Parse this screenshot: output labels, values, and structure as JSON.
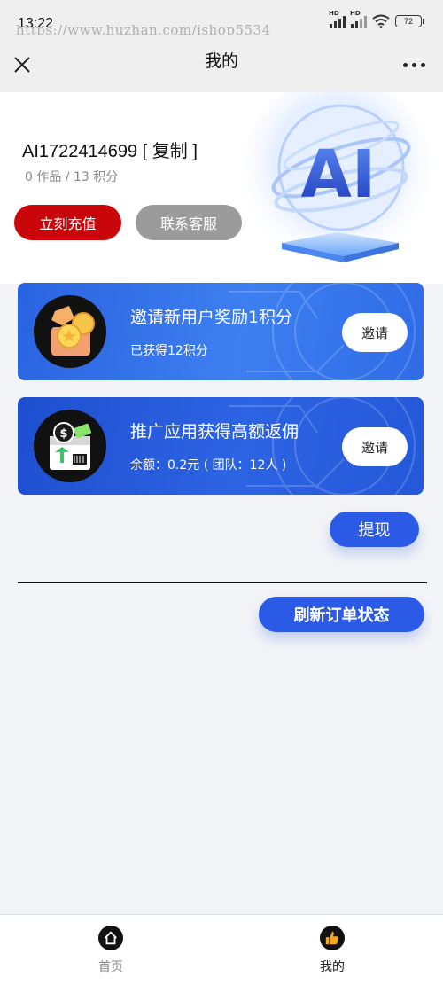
{
  "status_bar": {
    "time": "13:22",
    "watermark": "https://www.huzhan.com/ishop5534",
    "signal_1_tag": "HD",
    "signal_2_tag": "HD",
    "battery": "72"
  },
  "nav": {
    "title": "我的"
  },
  "profile": {
    "user_id": "AI1722414699 [ 复制 ]",
    "stats": "0 作品 / 13 积分",
    "recharge_label": "立刻充值",
    "service_label": "联系客服",
    "art_text": "AI"
  },
  "cards": [
    {
      "title": "邀请新用户奖励1积分",
      "subtitle": "已获得12积分",
      "button_label": "邀请",
      "icon": "gift-coins-icon"
    },
    {
      "title": "推广应用获得高额返佣",
      "subtitle": "余额：0.2元 ( 团队：12人 )",
      "button_label": "邀请",
      "icon": "money-box-icon"
    }
  ],
  "actions": {
    "withdraw_label": "提现",
    "refresh_label": "刷新订单状态"
  },
  "tabbar": {
    "items": [
      {
        "label": "首页",
        "icon": "home-icon"
      },
      {
        "label": "我的",
        "icon": "thumbs-up-icon"
      }
    ]
  },
  "colors": {
    "recharge": "#c9070a",
    "service": "#9b9b9b",
    "primary_button": "#2a5ae6",
    "card_blue": "#2a63e0"
  }
}
